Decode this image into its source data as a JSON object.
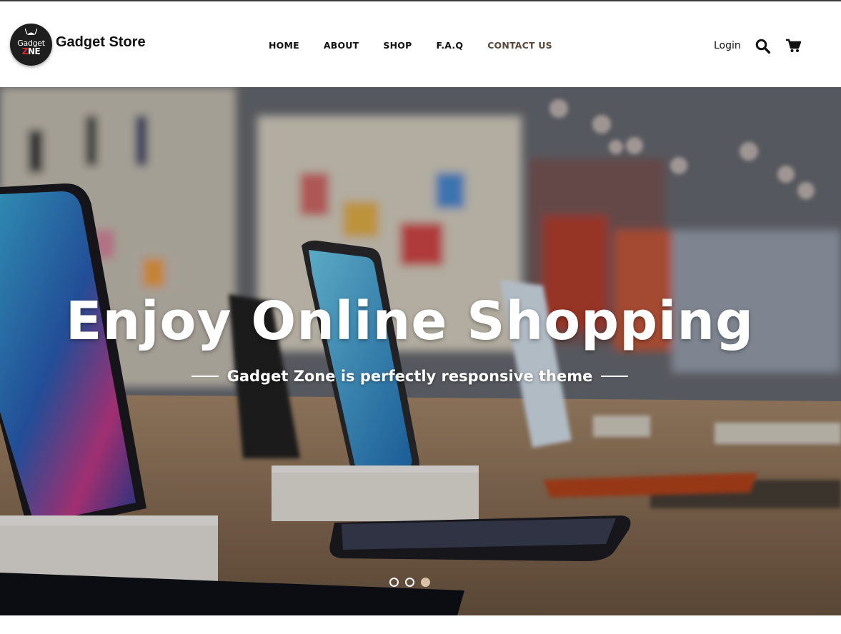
{
  "brand": {
    "logo_line1": "Gadget",
    "logo_line2_a": "Z",
    "logo_line2_b": "NE",
    "name": "Gadget Store"
  },
  "nav": {
    "items": [
      {
        "label": "HOME"
      },
      {
        "label": "ABOUT"
      },
      {
        "label": "SHOP"
      },
      {
        "label": "F.A.Q"
      },
      {
        "label": "CONTACT US"
      }
    ]
  },
  "header_actions": {
    "login_label": "Login",
    "search_icon": "search-icon",
    "cart_icon": "cart-icon"
  },
  "hero": {
    "title": "Enjoy Online Shopping",
    "subtitle": "Gadget Zone is perfectly responsive theme",
    "slides_count": 3,
    "active_slide": 3
  },
  "colors": {
    "nav_text": "#111111",
    "nav_contact": "#5a4636",
    "dot_active": "#d8c1a4",
    "logo_red": "#e8202a"
  }
}
